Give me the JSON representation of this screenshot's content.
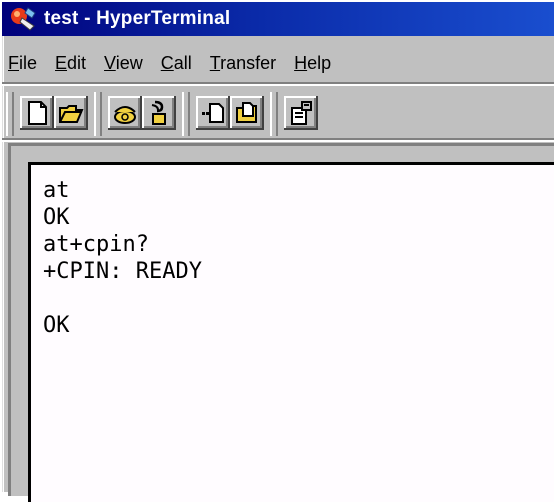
{
  "window": {
    "title": "test - HyperTerminal"
  },
  "menubar": {
    "items": [
      {
        "id": "file",
        "label_acc": "F",
        "label_rest": "ile"
      },
      {
        "id": "edit",
        "label_acc": "E",
        "label_rest": "dit"
      },
      {
        "id": "view",
        "label_acc": "V",
        "label_rest": "iew"
      },
      {
        "id": "call",
        "label_acc": "C",
        "label_rest": "all"
      },
      {
        "id": "transfer",
        "label_acc": "T",
        "label_rest": "ransfer"
      },
      {
        "id": "help",
        "label_acc": "H",
        "label_rest": "elp"
      }
    ]
  },
  "toolbar": {
    "buttons": [
      {
        "id": "new",
        "icon": "new-document-icon"
      },
      {
        "id": "open",
        "icon": "open-folder-icon"
      },
      {
        "id": "connect",
        "icon": "phone-connect-icon"
      },
      {
        "id": "disconnect",
        "icon": "phone-disconnect-icon"
      },
      {
        "id": "send",
        "icon": "send-file-icon"
      },
      {
        "id": "receive",
        "icon": "receive-file-icon"
      },
      {
        "id": "properties",
        "icon": "properties-icon"
      }
    ]
  },
  "terminal": {
    "lines": [
      "at",
      "OK",
      "at+cpin?",
      "+CPIN: READY",
      "",
      "OK"
    ]
  },
  "colors": {
    "titlebar_start": "#00007b",
    "titlebar_end": "#1a4fd0",
    "chrome": "#c0c0c0",
    "terminal_bg": "#fffcff"
  }
}
